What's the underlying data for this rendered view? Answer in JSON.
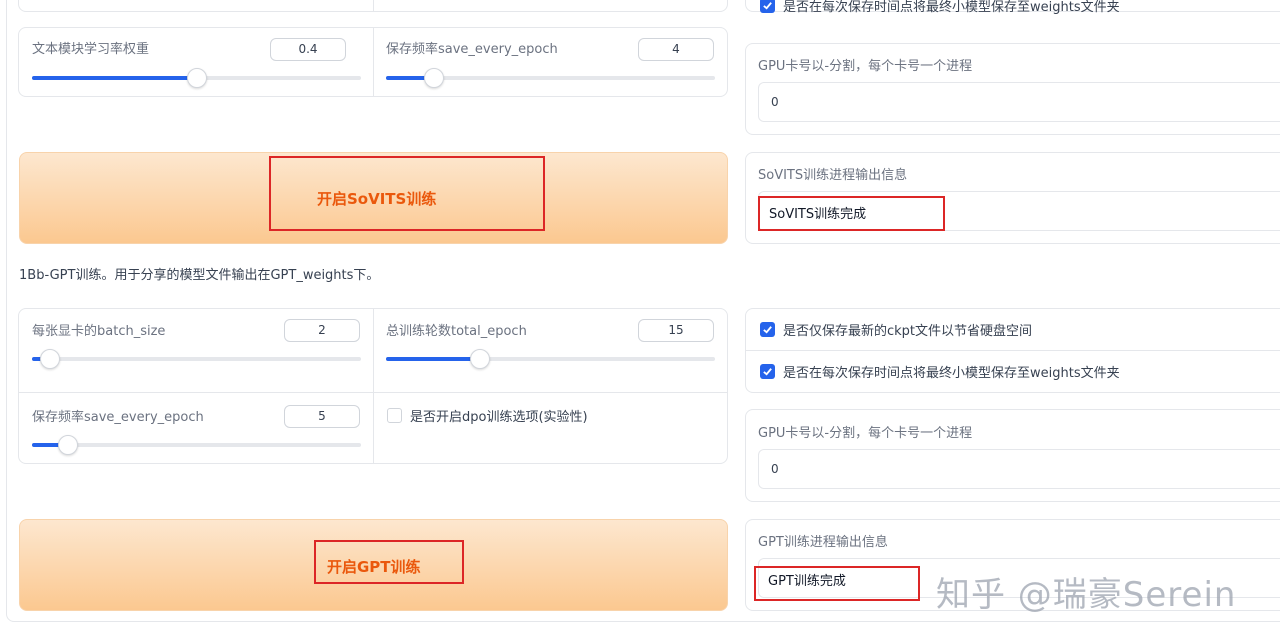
{
  "top": {
    "checkbox_weights": "是否在每次保存时间点将最终小模型保存至weights文件夹"
  },
  "sovits": {
    "text_lr_label": "文本模块学习率权重",
    "text_lr_value": "0.4",
    "text_lr_fraction": 0.4,
    "save_every_label": "保存频率save_every_epoch",
    "save_every_value": "4",
    "save_every_fraction": 0.15,
    "gpu_label": "GPU卡号以-分割，每个卡号一个进程",
    "gpu_value": "0",
    "button_label": "开启SoVITS训练",
    "output_label": "SoVITS训练进程输出信息",
    "output_value": "SoVITS训练完成"
  },
  "gpt_section_desc": "1Bb-GPT训练。用于分享的模型文件输出在GPT_weights下。",
  "gpt": {
    "batch_label": "每张显卡的batch_size",
    "batch_value": "2",
    "batch_fraction": 0.05,
    "epoch_label": "总训练轮数total_epoch",
    "epoch_value": "15",
    "epoch_fraction": 0.3,
    "save_every_label": "保存频率save_every_epoch",
    "save_every_value": "5",
    "save_every_fraction": 0.12,
    "dpo_label": "是否开启dpo训练选项(实验性)",
    "dpo_checked": false,
    "latest_ckpt_label": "是否仅保存最新的ckpt文件以节省硬盘空间",
    "latest_ckpt_checked": true,
    "weights_label": "是否在每次保存时间点将最终小模型保存至weights文件夹",
    "weights_checked": true,
    "gpu_label": "GPU卡号以-分割，每个卡号一个进程",
    "gpu_value": "0",
    "button_label": "开启GPT训练",
    "output_label": "GPT训练进程输出信息",
    "output_value": "GPT训练完成"
  },
  "watermark": "知乎 @瑞豪Serein",
  "colors": {
    "accent": "#2563eb",
    "button_text": "#ea580c",
    "highlight_box": "#dc2626"
  }
}
